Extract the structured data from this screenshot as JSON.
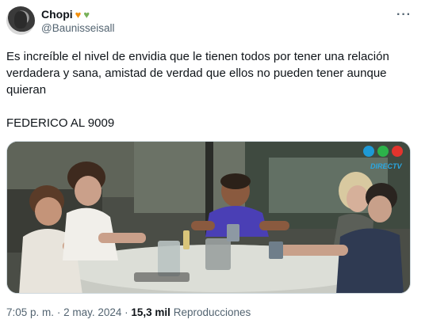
{
  "author": {
    "display_name": "Chopi",
    "handle": "@Baunisseisall",
    "emojis": [
      "orange-heart",
      "green-heart"
    ]
  },
  "tweet": {
    "text_paragraph_1": "Es increíble el nivel de envidia que le tienen todos por tener una relación verdadera y sana, amistad de verdad que ellos no pueden tener aunque quieran",
    "text_paragraph_2": "FEDERICO AL 9009",
    "time": "7:05 p. m.",
    "date": "2 may. 2024",
    "views_count": "15,3 mil",
    "views_label": "Reproducciones",
    "separator": "·"
  },
  "media": {
    "channel_logo_text": "DIRECTV",
    "description_icon": "tv-broadcast-photo"
  },
  "colors": {
    "text_primary": "#0f1419",
    "text_secondary": "#536471",
    "border": "#cfd9de"
  }
}
